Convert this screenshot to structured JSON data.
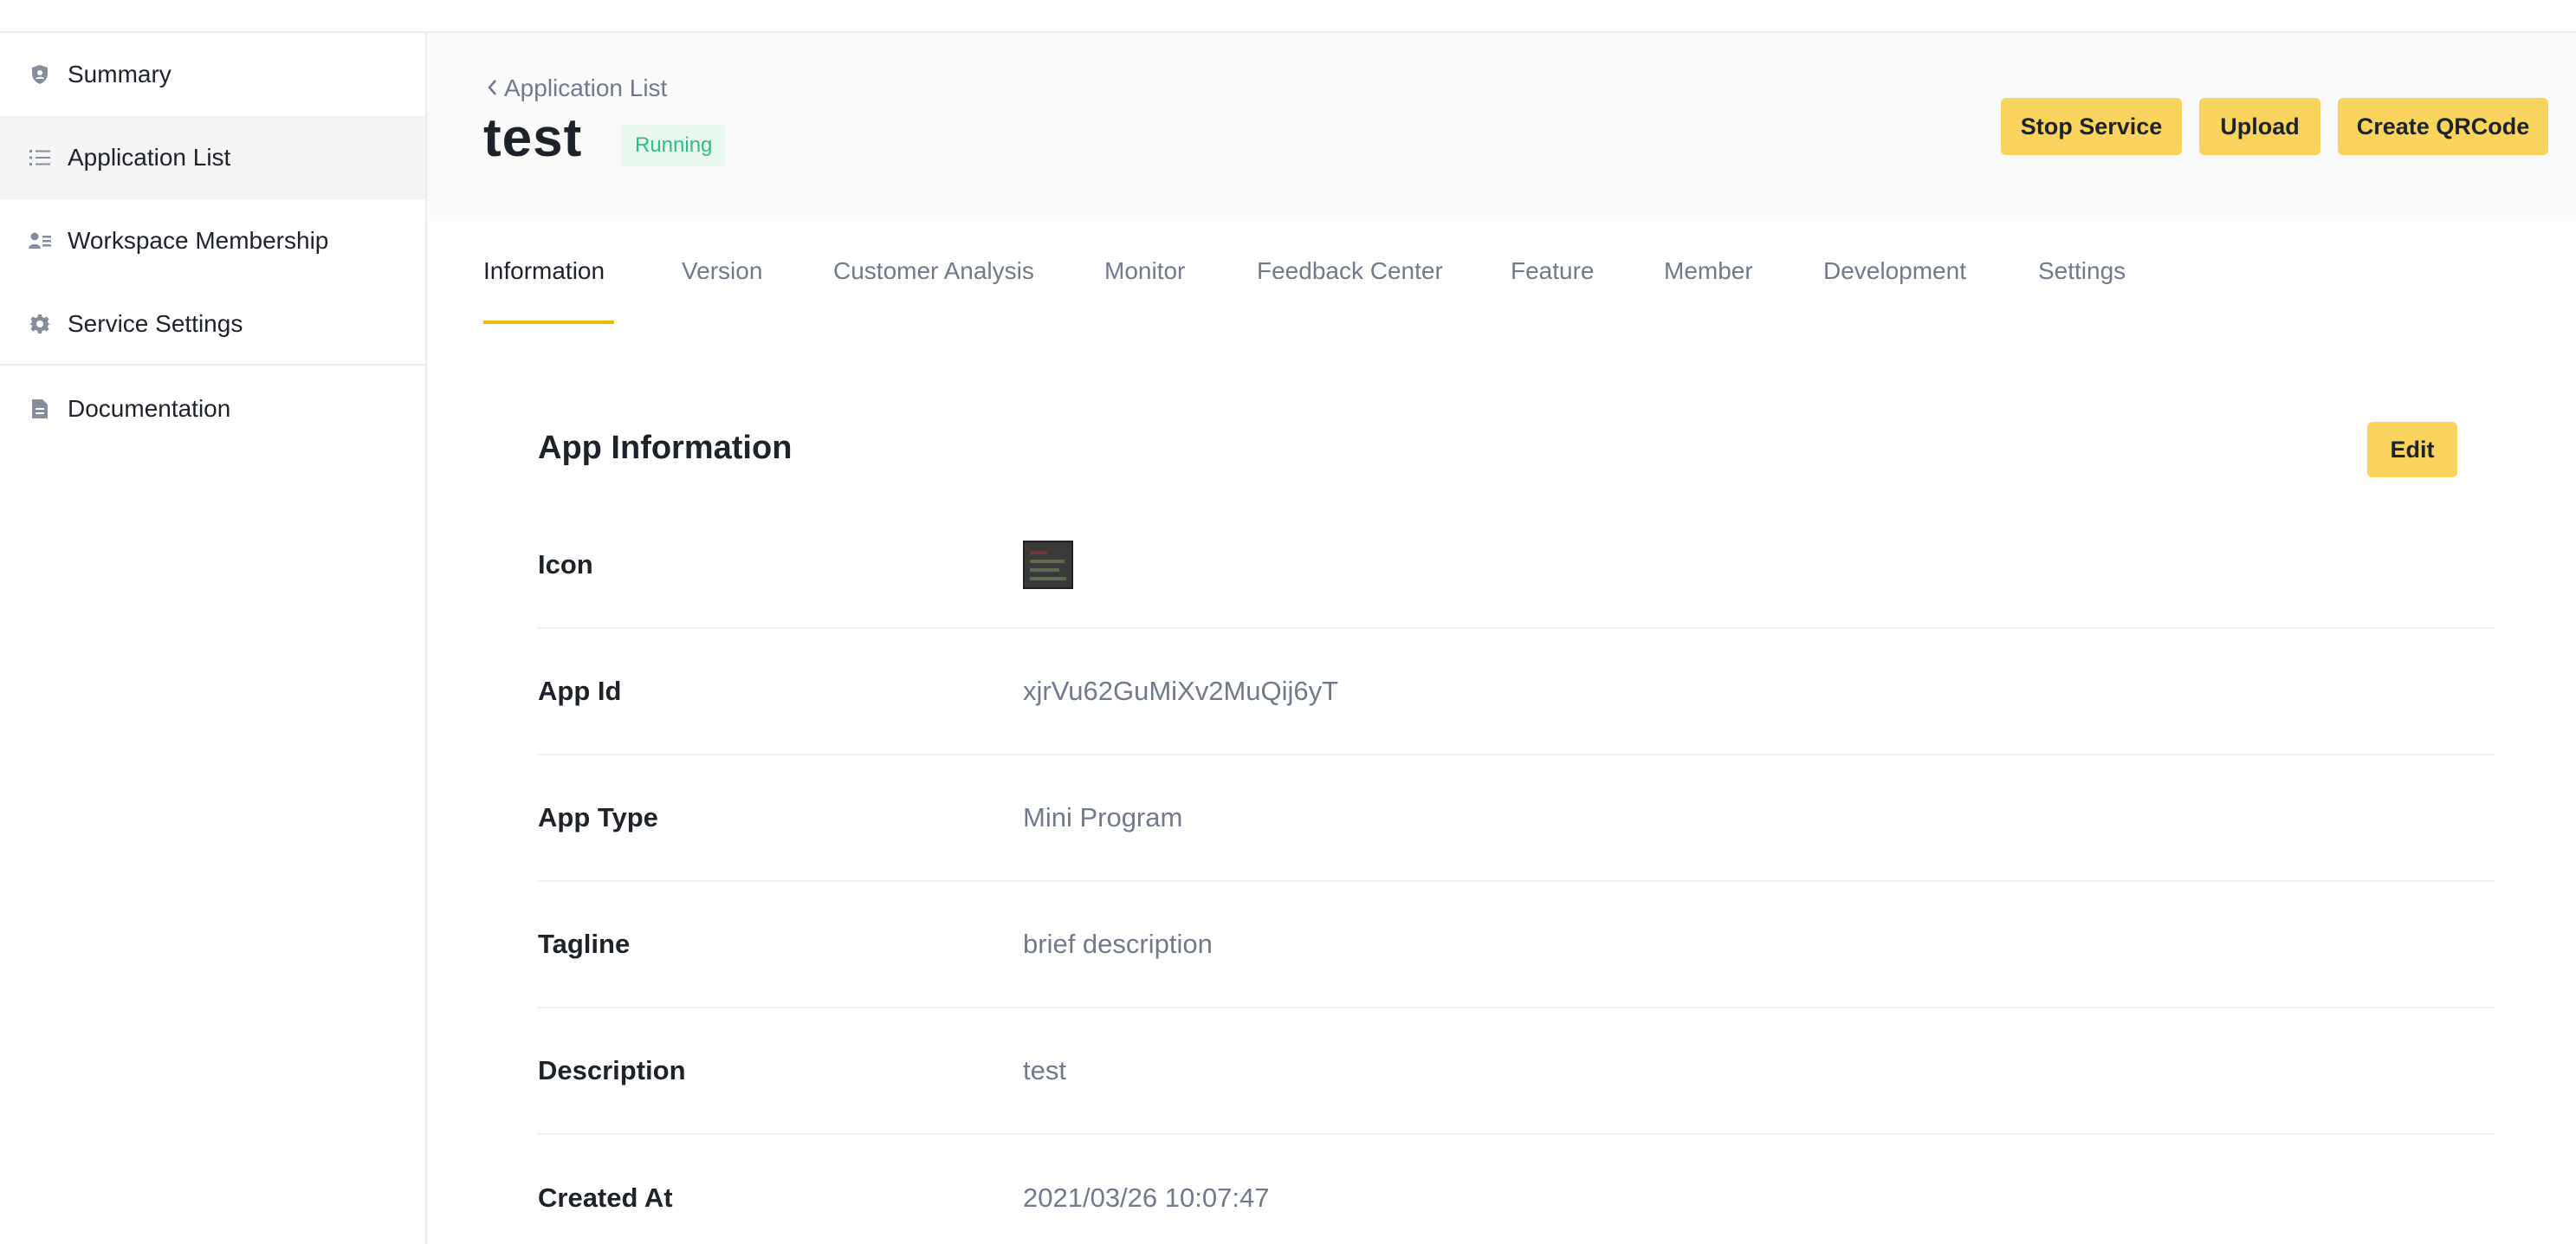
{
  "sidebar": {
    "items": [
      {
        "label": "Summary",
        "icon": "shield-icon"
      },
      {
        "label": "Application List",
        "icon": "list-icon",
        "active": true
      },
      {
        "label": "Workspace Membership",
        "icon": "people-icon"
      },
      {
        "label": "Service Settings",
        "icon": "gear-icon"
      },
      {
        "label": "Documentation",
        "icon": "document-icon"
      }
    ]
  },
  "header": {
    "breadcrumb": "Application List",
    "title": "test",
    "status": "Running",
    "buttons": {
      "stop": "Stop Service",
      "upload": "Upload",
      "qrcode": "Create QRCode"
    }
  },
  "tabs": [
    {
      "label": "Information",
      "active": true
    },
    {
      "label": "Version"
    },
    {
      "label": "Customer Analysis"
    },
    {
      "label": "Monitor"
    },
    {
      "label": "Feedback Center"
    },
    {
      "label": "Feature"
    },
    {
      "label": "Member"
    },
    {
      "label": "Development"
    },
    {
      "label": "Settings"
    }
  ],
  "info": {
    "title": "App Information",
    "edit_label": "Edit",
    "rows": [
      {
        "label": "Icon",
        "value": ""
      },
      {
        "label": "App Id",
        "value": "xjrVu62GuMiXv2MuQij6yT"
      },
      {
        "label": "App Type",
        "value": "Mini Program"
      },
      {
        "label": "Tagline",
        "value": "brief description"
      },
      {
        "label": "Description",
        "value": "test"
      },
      {
        "label": "Created At",
        "value": "2021/03/26 10:07:47"
      }
    ]
  },
  "colors": {
    "accent": "#f8d45c",
    "tab_underline": "#f0b90b",
    "status_text": "#2ebd85",
    "status_bg": "#eaf7ee"
  }
}
